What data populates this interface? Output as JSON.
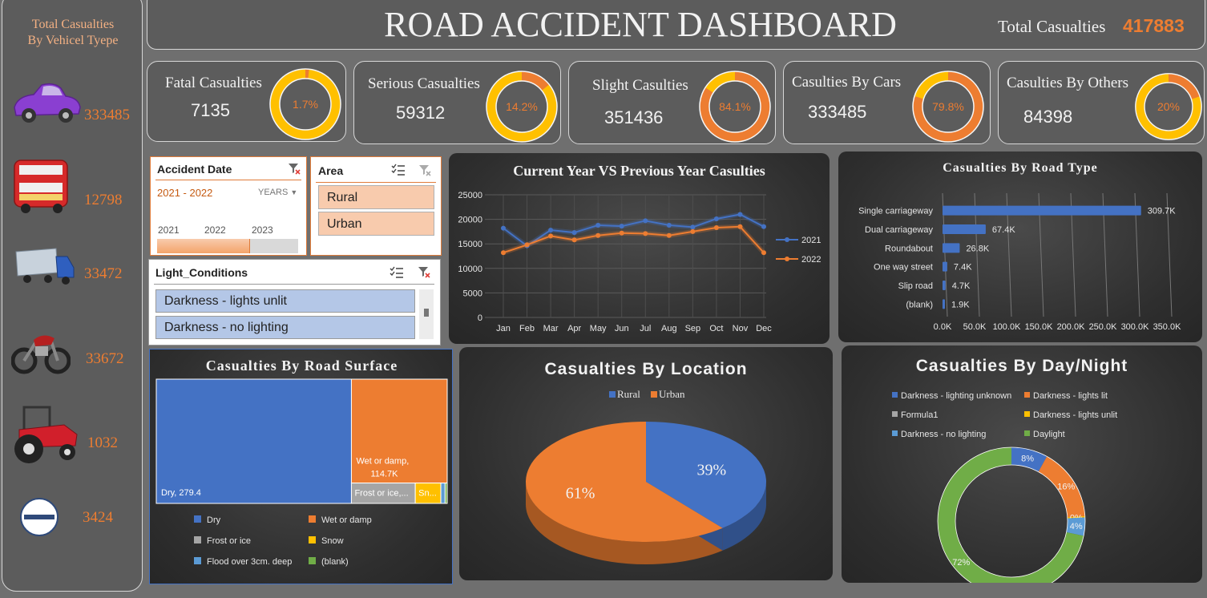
{
  "header": {
    "title": "ROAD ACCIDENT DASHBOARD",
    "total_label": "Total Casualties",
    "total_value": "417883"
  },
  "sidebar": {
    "title_line1": "Total Casualties",
    "title_line2": "By Vehicel Tyepe",
    "items": [
      {
        "icon": "car-icon",
        "value": "333485"
      },
      {
        "icon": "bus-icon",
        "value": "12798"
      },
      {
        "icon": "truck-icon",
        "value": "33472"
      },
      {
        "icon": "motorcycle-icon",
        "value": "33672"
      },
      {
        "icon": "tractor-icon",
        "value": "1032"
      },
      {
        "icon": "no-entry-icon",
        "value": "3424"
      }
    ]
  },
  "kpis": [
    {
      "label": "Fatal Casualties",
      "value": "7135",
      "pct_label": "1.7%",
      "pct": 1.7
    },
    {
      "label": "Serious Casualties",
      "value": "59312",
      "pct_label": "14.2%",
      "pct": 14.2
    },
    {
      "label": "Slight Casulties",
      "value": "351436",
      "pct_label": "84.1%",
      "pct": 84.1
    },
    {
      "label": "Casulties By Cars",
      "value": "333485",
      "pct_label": "79.8%",
      "pct": 79.8
    },
    {
      "label": "Casulties By Others",
      "value": "84398",
      "pct_label": "20%",
      "pct": 20
    }
  ],
  "slicers": {
    "date": {
      "title": "Accident Date",
      "range": "2021 - 2022",
      "level": "YEARS",
      "years": [
        "2021",
        "2022",
        "2023"
      ]
    },
    "area": {
      "title": "Area",
      "options": [
        "Rural",
        "Urban"
      ]
    },
    "light": {
      "title": "Light_Conditions",
      "options": [
        "Darkness - lights unlit",
        "Darkness - no lighting"
      ]
    }
  },
  "colors": {
    "accent": "#ed7d31",
    "blue": "#4472c4",
    "yellow": "#ffc000",
    "green": "#70ad47",
    "grey": "#a5a5a5",
    "lightblue": "#5b9bd5"
  },
  "chart_data": [
    {
      "id": "cy_vs_py",
      "type": "line",
      "title": "Current Year VS Previous Year Casulties",
      "categories": [
        "Jan",
        "Feb",
        "Mar",
        "Apr",
        "May",
        "Jun",
        "Jul",
        "Aug",
        "Sep",
        "Oct",
        "Nov",
        "Dec"
      ],
      "series": [
        {
          "name": "2021",
          "color": "#4472c4",
          "values": [
            18200,
            14600,
            17800,
            17300,
            18800,
            18600,
            19700,
            18800,
            18400,
            20100,
            21000,
            18500
          ]
        },
        {
          "name": "2022",
          "color": "#ed7d31",
          "values": [
            13200,
            14800,
            16600,
            15800,
            16700,
            17200,
            17100,
            16700,
            17500,
            18300,
            18500,
            13200
          ]
        }
      ],
      "ylim": [
        0,
        25000
      ],
      "yticks": [
        "0",
        "5000",
        "10000",
        "15000",
        "20000",
        "25000"
      ],
      "legend": "right",
      "grid": true
    },
    {
      "id": "road_type",
      "type": "bar",
      "orientation": "horizontal",
      "title": "Casualties By Road Type",
      "categories": [
        "Single carriageway",
        "Dual carriageway",
        "Roundabout",
        "One way street",
        "Slip road",
        "(blank)"
      ],
      "values": [
        309.7,
        67.4,
        26.8,
        7.4,
        4.7,
        1.9
      ],
      "value_labels": [
        "309.7K",
        "67.4K",
        "26.8K",
        "7.4K",
        "4.7K",
        "1.9K"
      ],
      "xlim": [
        0,
        350
      ],
      "xticks": [
        "0.0K",
        "50.0K",
        "100.0K",
        "150.0K",
        "200.0K",
        "250.0K",
        "300.0K",
        "350.0K"
      ],
      "color": "#4472c4"
    },
    {
      "id": "road_surface",
      "type": "treemap",
      "title": "Casualties By Road Surface",
      "items": [
        {
          "name": "Dry",
          "value": 279.4,
          "label": "Dry, 279.4",
          "color": "#4472c4"
        },
        {
          "name": "Wet or damp",
          "value": 114.7,
          "label": "Wet or damp, 114.7K",
          "color": "#ed7d31"
        },
        {
          "name": "Frost or ice",
          "value": 15.0,
          "label": "Frost or ice,...",
          "color": "#a5a5a5"
        },
        {
          "name": "Snow",
          "value": 6.0,
          "label": "Sn...",
          "color": "#ffc000"
        },
        {
          "name": "Flood over 3cm. deep",
          "value": 1.0,
          "label": "",
          "color": "#5b9bd5"
        },
        {
          "name": "(blank)",
          "value": 0.5,
          "label": "",
          "color": "#70ad47"
        }
      ],
      "legend": [
        "Dry",
        "Wet or damp",
        "Frost or ice",
        "Snow",
        "Flood over 3cm. deep",
        "(blank)"
      ]
    },
    {
      "id": "location",
      "type": "pie",
      "title": "Casualties By Location",
      "series": [
        {
          "name": "Rural",
          "value": 39,
          "label": "39%",
          "color": "#4472c4"
        },
        {
          "name": "Urban",
          "value": 61,
          "label": "61%",
          "color": "#ed7d31"
        }
      ],
      "legend": "top"
    },
    {
      "id": "day_night",
      "type": "pie",
      "variant": "donut",
      "title": "Casualties By Day/Night",
      "series": [
        {
          "name": "Darkness - lighting unknown",
          "value": 8,
          "label": "8%",
          "color": "#4472c4"
        },
        {
          "name": "Darkness - lights lit",
          "value": 16,
          "label": "16%",
          "color": "#ed7d31"
        },
        {
          "name": "Formula1",
          "value": 0,
          "label": "",
          "color": "#a5a5a5"
        },
        {
          "name": "Darkness - lights unlit",
          "value": 0.3,
          "label": "0%",
          "color": "#ffc000"
        },
        {
          "name": "Darkness - no lighting",
          "value": 4,
          "label": "4%",
          "color": "#5b9bd5"
        },
        {
          "name": "Daylight",
          "value": 72,
          "label": "72%",
          "color": "#70ad47"
        }
      ],
      "legend": "top"
    }
  ]
}
